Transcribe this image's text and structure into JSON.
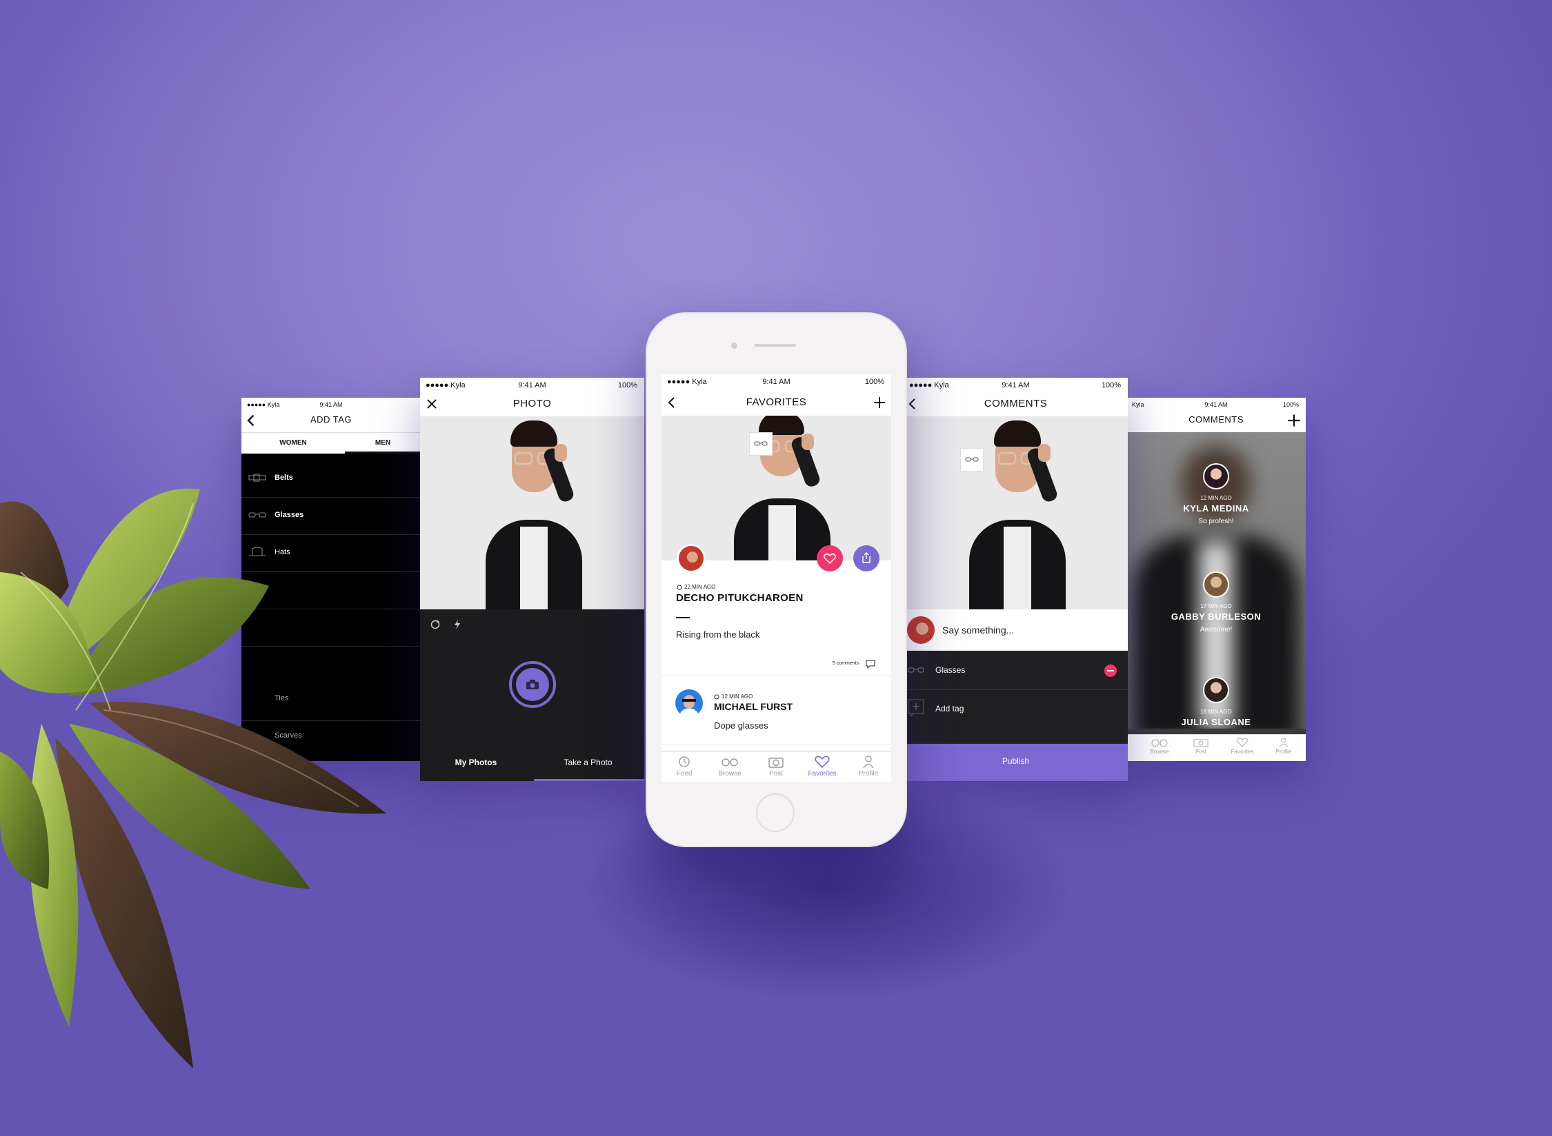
{
  "status": {
    "carrier": "Kyla",
    "time": "9:41 AM",
    "battery": "100%"
  },
  "screen_add_tag": {
    "title": "ADD TAG",
    "tabs": [
      "WOMEN",
      "MEN"
    ],
    "items": [
      "Belts",
      "Glasses",
      "Hats",
      "Ties",
      "Scarves"
    ]
  },
  "screen_photo": {
    "title": "PHOTO",
    "bottom_tabs": [
      "My Photos",
      "Take a Photo"
    ]
  },
  "screen_favorites": {
    "title": "FAVORITES",
    "post": {
      "time": "22 MIN AGO",
      "author": "DECHO PITUKCHAROEN",
      "caption": "Rising from the black",
      "comments": "5 comments"
    },
    "comment": {
      "time": "12 MIN AGO",
      "author": "MICHAEL FURST",
      "text": "Dope glasses"
    },
    "tabs": [
      "Feed",
      "Browse",
      "Post",
      "Favorites",
      "Profile"
    ],
    "accent": "#7b68d0",
    "like_color": "#f0366b"
  },
  "screen_comments": {
    "title": "COMMENTS",
    "placeholder": "Say something...",
    "tag": "Glasses",
    "add_tag": "Add tag",
    "publish": "Publish"
  },
  "screen_comments_2": {
    "title": "COMMENTS",
    "entries": [
      {
        "time": "12 MIN AGO",
        "name": "KYLA MEDINA",
        "text": "So profesh!"
      },
      {
        "time": "17 MIN AGO",
        "name": "GABBY BURLESON",
        "text": "Awesome!"
      },
      {
        "time": "18 MIN AGO",
        "name": "JULIA SLOANE",
        "text": ""
      }
    ],
    "tabs": [
      "Browse",
      "Post",
      "Favorites",
      "Profile"
    ]
  }
}
